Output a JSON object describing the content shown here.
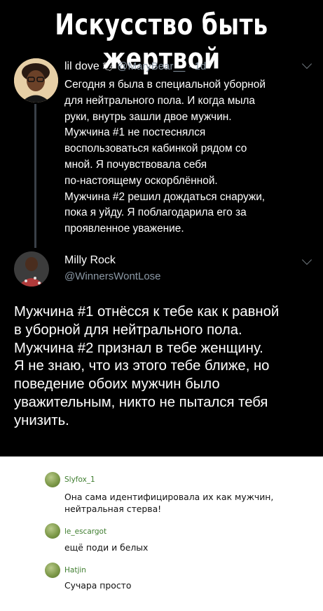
{
  "title": "Искусство быть жертвой",
  "tweet1": {
    "name": "lil dove",
    "badge": "🕊",
    "handle": "@MaryBear__ · 1d",
    "text": "Сегодня я была в специальной уборной\nдля нейтрального пола. И когда мыла\nруки, внутрь зашли двое мужчин.\nМужчина #1 не постеснялся\nвоспользоваться кабинкой рядом со\nмной. Я почувствовала себя\nпо-настоящему оскорблённой.\nМужчина #2 решил дождаться снаружи,\nпока я уйду. Я поблагодарила его за\nпроявленное уважение."
  },
  "tweet2": {
    "name": "Milly Rock",
    "handle": "@WinnersWontLose",
    "text": "Мужчина #1 отнёсся к тебе как к равной\nв уборной для нейтрального пола.\nМужчина #2 признал в тебе женщину.\nЯ не знаю, что из этого тебе ближе, но\nповедение обоих мужчин было\nуважительным, никто не пытался тебя\nунизить."
  },
  "comments": [
    {
      "author": "Slyfox_1",
      "text": "Она сама идентифицировала их как мужчин,\nнейтральная стерва!"
    },
    {
      "author": "le_escargot",
      "text": "ещё поди и белых"
    },
    {
      "author": "Hatjin",
      "text": "Сучара просто"
    }
  ],
  "colors": {
    "background": "#000000",
    "handle": "#8b98a5",
    "comment_author": "#3f7d2f"
  }
}
